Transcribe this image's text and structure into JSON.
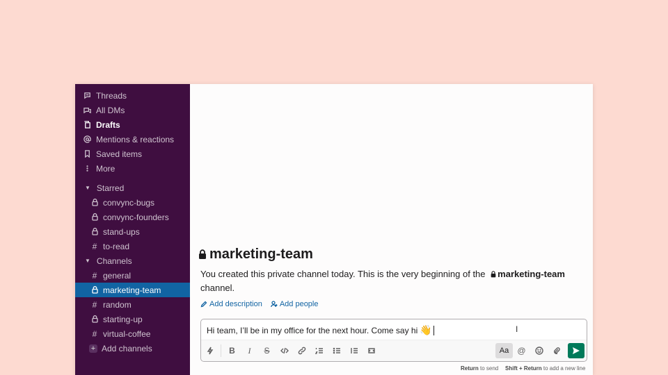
{
  "sidebar": {
    "nav": [
      {
        "label": "Threads",
        "icon": "threads-icon"
      },
      {
        "label": "All DMs",
        "icon": "dms-icon"
      },
      {
        "label": "Drafts",
        "icon": "drafts-icon",
        "bold": true
      },
      {
        "label": "Mentions & reactions",
        "icon": "mention-icon"
      },
      {
        "label": "Saved items",
        "icon": "bookmark-icon"
      },
      {
        "label": "More",
        "icon": "more-icon"
      }
    ],
    "starred": {
      "title": "Starred",
      "channels": [
        {
          "name": "convync-bugs",
          "private": true
        },
        {
          "name": "convync-founders",
          "private": true
        },
        {
          "name": "stand-ups",
          "private": true
        },
        {
          "name": "to-read",
          "private": false
        }
      ]
    },
    "channels": {
      "title": "Channels",
      "items": [
        {
          "name": "general",
          "private": false
        },
        {
          "name": "marketing-team",
          "private": true,
          "active": true
        },
        {
          "name": "random",
          "private": false
        },
        {
          "name": "starting-up",
          "private": true
        },
        {
          "name": "virtual-coffee",
          "private": false
        }
      ],
      "add_label": "Add channels"
    }
  },
  "channel": {
    "title": "marketing-team",
    "intro_before": "You created this private channel today. This is the very beginning of the",
    "intro_name": "marketing-team",
    "intro_after": "channel.",
    "add_description": "Add description",
    "add_people": "Add people"
  },
  "composer": {
    "message": "Hi team, I’ll be in my office for the next hour. Come say hi",
    "emoji": "👋",
    "format_label": "Aa"
  },
  "hints": {
    "send_key": "Return",
    "send_text": "to send",
    "newline_key": "Shift + Return",
    "newline_text": "to add a new line"
  },
  "colors": {
    "background": "#fddad1",
    "sidebar": "#3f0e40",
    "active": "#1164a3",
    "send": "#007a5a"
  }
}
